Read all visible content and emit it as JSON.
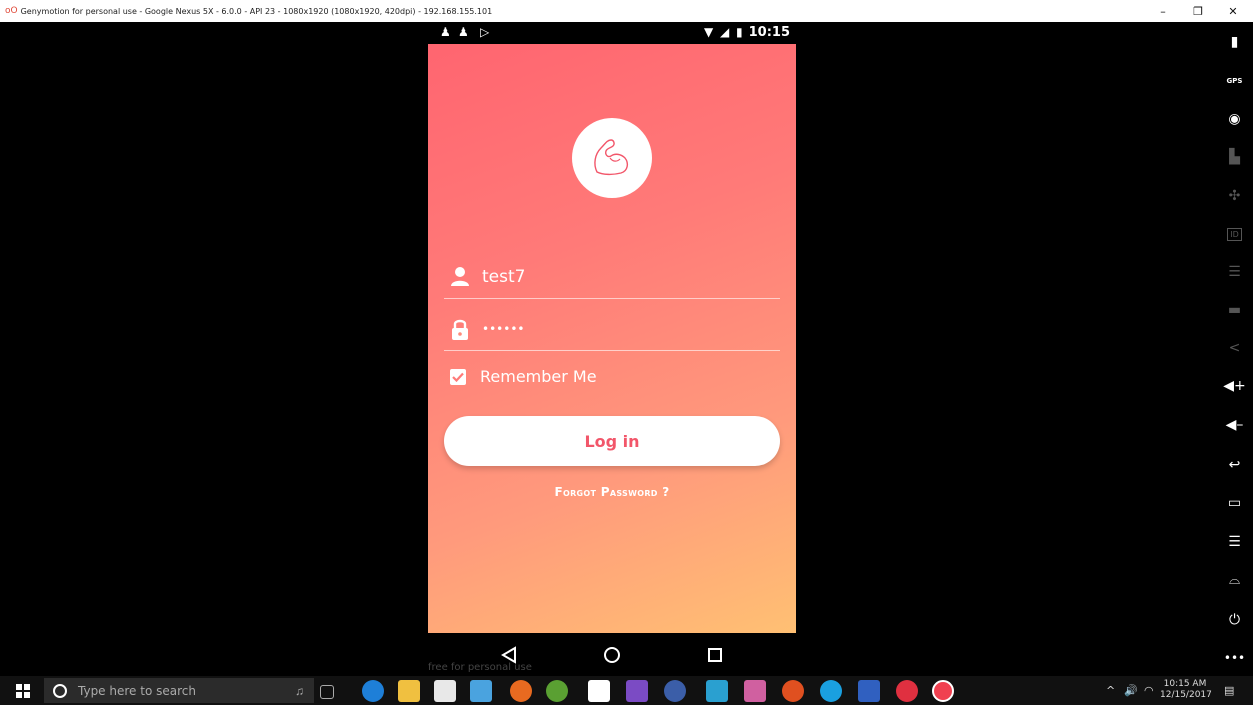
{
  "window": {
    "title": "Genymotion for personal use - Google Nexus 5X - 6.0.0 - API 23 - 1080x1920 (1080x1920, 420dpi) - 192.168.155.101",
    "logo": "oO",
    "minimize": "–",
    "maximize": "❐",
    "close": "✕"
  },
  "statusbar": {
    "time": "10:15"
  },
  "login": {
    "username": "test7",
    "password_mask": "••••••",
    "remember_label": "Remember Me",
    "remember_checked": true,
    "login_label": "Log in",
    "forgot_label": "Forgot Password ?"
  },
  "colors": {
    "gradient_top": "#ff6570",
    "gradient_bottom": "#ffc073",
    "button_text": "#f2566a"
  },
  "watermark": "free for personal use",
  "toolbar": {
    "items": [
      "battery-icon",
      "gps-icon",
      "webcam-icon",
      "capture-icon",
      "dpad-icon",
      "device-id-icon",
      "network-icon",
      "sms-icon",
      "share-icon",
      "volume-up-icon",
      "volume-down-icon",
      "rotate-icon",
      "recent-apps-icon",
      "menu-icon",
      "home-icon",
      "power-icon",
      "more-icon"
    ],
    "gps_label": "GPS",
    "id_label": "ID",
    "more_label": "•••"
  },
  "taskbar": {
    "search_placeholder": "Type here to search",
    "tray_caret": "^",
    "clock_time": "10:15 AM",
    "clock_date": "12/15/2017"
  }
}
